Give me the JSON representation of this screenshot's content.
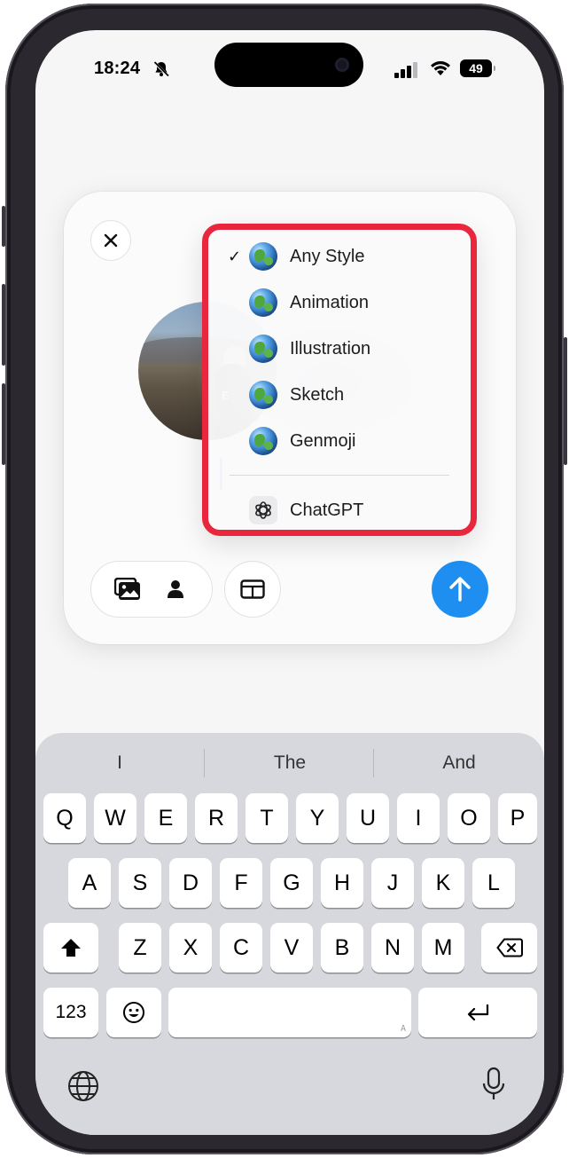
{
  "status_bar": {
    "time": "18:24",
    "battery": "49"
  },
  "style_menu": {
    "items": [
      {
        "label": "Any Style",
        "checked": true,
        "icon": "globe-icon"
      },
      {
        "label": "Animation",
        "checked": false,
        "icon": "globe-icon"
      },
      {
        "label": "Illustration",
        "checked": false,
        "icon": "globe-icon"
      },
      {
        "label": "Sketch",
        "checked": false,
        "icon": "globe-icon"
      },
      {
        "label": "Genmoji",
        "checked": false,
        "icon": "globe-icon"
      }
    ],
    "chatgpt_label": "ChatGPT",
    "check_mark": "✓",
    "highlight_color": "#e8263e"
  },
  "card": {
    "avatar_caption": "E",
    "buttons": {
      "close_icon": "close-icon",
      "photos_icon": "photo-library-icon",
      "person_icon": "person-icon",
      "layout_icon": "layout-icon",
      "send_icon": "arrow-up-icon"
    },
    "send_color": "#1f8ef1"
  },
  "keyboard": {
    "suggestions": [
      "I",
      "The",
      "And"
    ],
    "row1": [
      "Q",
      "W",
      "E",
      "R",
      "T",
      "Y",
      "U",
      "I",
      "O",
      "P"
    ],
    "row2": [
      "A",
      "S",
      "D",
      "F",
      "G",
      "H",
      "J",
      "K",
      "L"
    ],
    "row3": [
      "Z",
      "X",
      "C",
      "V",
      "B",
      "N",
      "M"
    ],
    "numbers_key": "123",
    "space_hint": "A"
  }
}
